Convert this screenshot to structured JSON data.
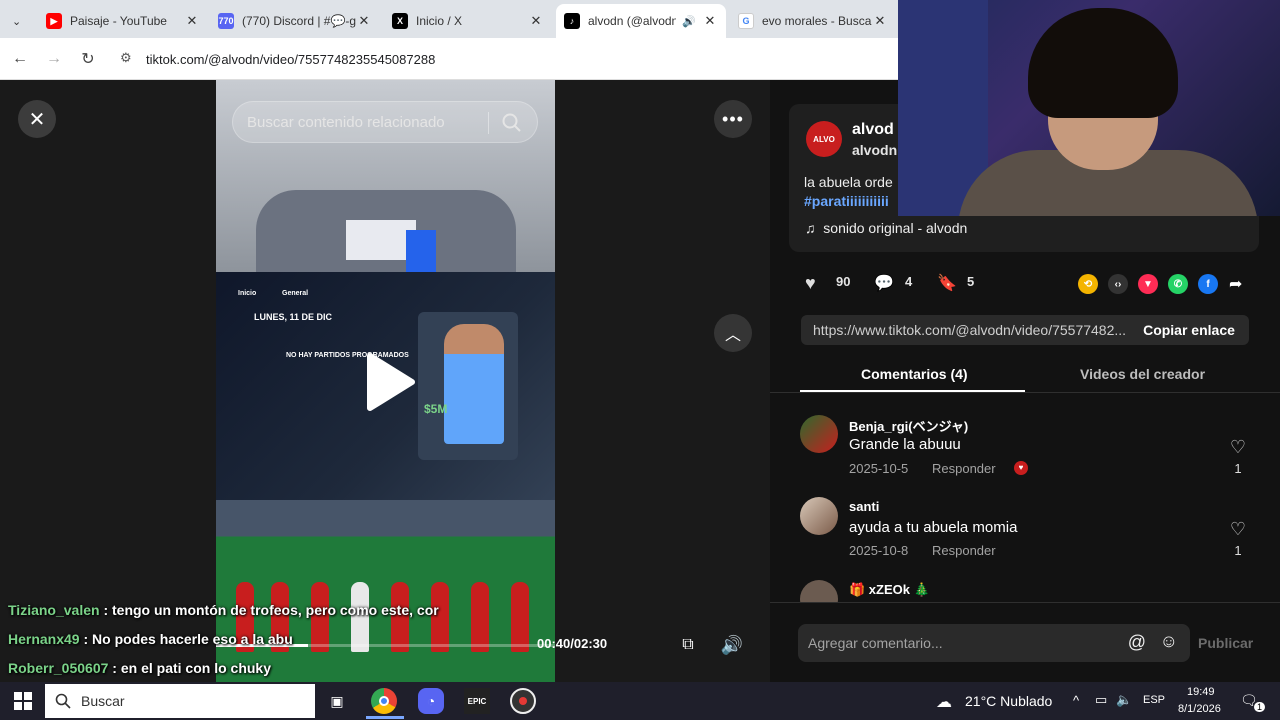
{
  "browser": {
    "tabs": [
      {
        "title": "Paisaje - YouTube",
        "favicon": "youtube-icon"
      },
      {
        "title": "(770) Discord | #💬-g",
        "favicon": "discord-icon",
        "badge": "770"
      },
      {
        "title": "Inicio / X",
        "favicon": "x-icon"
      },
      {
        "title": "alvodn (@alvodn",
        "favicon": "tiktok-icon"
      },
      {
        "title": "evo morales - Buscar",
        "favicon": "google-icon"
      }
    ],
    "url": "tiktok.com/@alvodn/video/7557748235545087288"
  },
  "video": {
    "search_placeholder": "Buscar contenido relacionado",
    "timecode": "00:40/02:30",
    "screen_text": {
      "date": "LUNES, 11 DE DIC",
      "no_matches": "NO HAY PARTIDOS PROGRAMADOS",
      "price": "$5M",
      "nav_inicio": "Inicio",
      "nav_general": "General"
    }
  },
  "chat": [
    {
      "user": "Tiziano_valen",
      "text": ": tengo un montón de trofeos, pero como este, cor"
    },
    {
      "user": "Hernanx49",
      "text": ": No podes hacerle eso a la abu"
    },
    {
      "user": "Roberr_050607",
      "text": ": en el pati con lo chuky"
    }
  ],
  "creator": {
    "display_name": "alvod",
    "username": "alvodn",
    "avatar_text": "ALVO",
    "caption": "la abuela orde",
    "hashtag": "#paratiiiiiiiiiii",
    "sound": "sonido original - alvodn"
  },
  "stats": {
    "likes": "90",
    "comments": "4",
    "saves": "5"
  },
  "link": {
    "url": "https://www.tiktok.com/@alvodn/video/75577482...",
    "copy_label": "Copiar enlace"
  },
  "panel_tabs": {
    "comments": "Comentarios (4)",
    "creator_videos": "Videos del creador"
  },
  "comments": [
    {
      "name": "Benja_rgi(ベンジャ)",
      "text": "Grande la abuuu",
      "date": "2025-10-5",
      "reply": "Responder",
      "likes": "1"
    },
    {
      "name": "santi",
      "text": "ayuda a tu abuela momia",
      "date": "2025-10-8",
      "reply": "Responder",
      "likes": "1"
    },
    {
      "name": "🎁 xZEOk 🎄",
      "text": "",
      "date": "",
      "reply": "",
      "likes": ""
    }
  ],
  "comment_input": {
    "placeholder": "Agregar comentario...",
    "publish": "Publicar"
  },
  "taskbar": {
    "search": "Buscar",
    "weather": "21°C Nublado",
    "lang": "ESP",
    "time": "19:49",
    "date": "8/1/2026",
    "notifications": "1"
  },
  "colors": {
    "tiktok_red": "#fe2c55",
    "chat_user": "#7bd389",
    "link_blue": "#6aa7ff"
  }
}
